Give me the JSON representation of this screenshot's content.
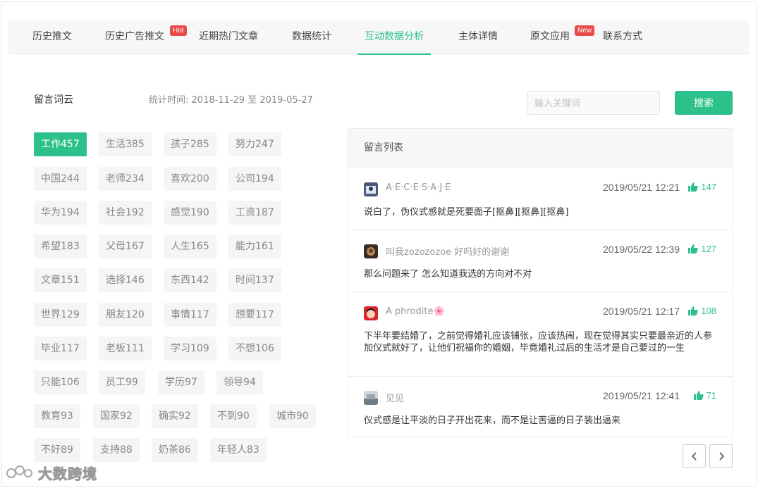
{
  "tabs": [
    {
      "label": "历史推文"
    },
    {
      "label": "历史广告推文",
      "badge": "Hot"
    },
    {
      "label": "近期热门文章"
    },
    {
      "label": "数据统计"
    },
    {
      "label": "互动数据分析"
    },
    {
      "label": "主体详情"
    },
    {
      "label": "原文应用",
      "badge": "New"
    },
    {
      "label": "联系方式"
    }
  ],
  "wordcloud": {
    "title": "留言词云",
    "stat_label": "统计时间:",
    "stat_range": "2018-11-29 至 2019-05-27",
    "tags": [
      "工作457",
      "生活385",
      "孩子285",
      "努力247",
      "中国244",
      "老师234",
      "喜欢200",
      "公司194",
      "华为194",
      "社会192",
      "感觉190",
      "工资187",
      "希望183",
      "父母167",
      "人生165",
      "能力161",
      "文章151",
      "选择146",
      "东西142",
      "时间137",
      "世界129",
      "朋友120",
      "事情117",
      "想要117",
      "毕业117",
      "老板111",
      "学习109",
      "不想106",
      "只能106",
      "员工99",
      "学历97",
      "领导94",
      "教育93",
      "国家92",
      "确实92",
      "不到90",
      "城市90",
      "不好89",
      "支持88",
      "奶茶86",
      "年轻人83"
    ]
  },
  "search": {
    "placeholder": "输入关键词",
    "button": "搜索"
  },
  "comments": {
    "title": "留言列表",
    "items": [
      {
        "user": "A·E·C·E·S·A·J·E",
        "time": "2019/05/21 12:21",
        "likes": "147",
        "text": "说白了，伪仪式感就是死要面子[抠鼻][抠鼻][抠鼻]"
      },
      {
        "user": "叫我zozozozoe 好吗好的谢谢",
        "time": "2019/05/22 12:39",
        "likes": "127",
        "text": "那么问题来了 怎么知道我选的方向对不对"
      },
      {
        "user": "A phrodite🌸",
        "time": "2019/05/21 12:17",
        "likes": "108",
        "text": "下半年要结婚了，之前觉得婚礼应该铺张，应该热闹，现在觉得其实只要最亲近的人参加仪式就好了，让他们祝福你的婚姻，毕竟婚礼过后的生活才是自己要过的一生"
      },
      {
        "user": "见见",
        "time": "2019/05/21 12:41",
        "likes": "71",
        "text": "仪式感是让平淡的日子开出花来，而不是让苦逼的日子装出逼来"
      }
    ]
  },
  "watermark": {
    "text": "大数跨境"
  },
  "colors": {
    "accent": "#2cc18a",
    "badge": "#e84a4a"
  }
}
